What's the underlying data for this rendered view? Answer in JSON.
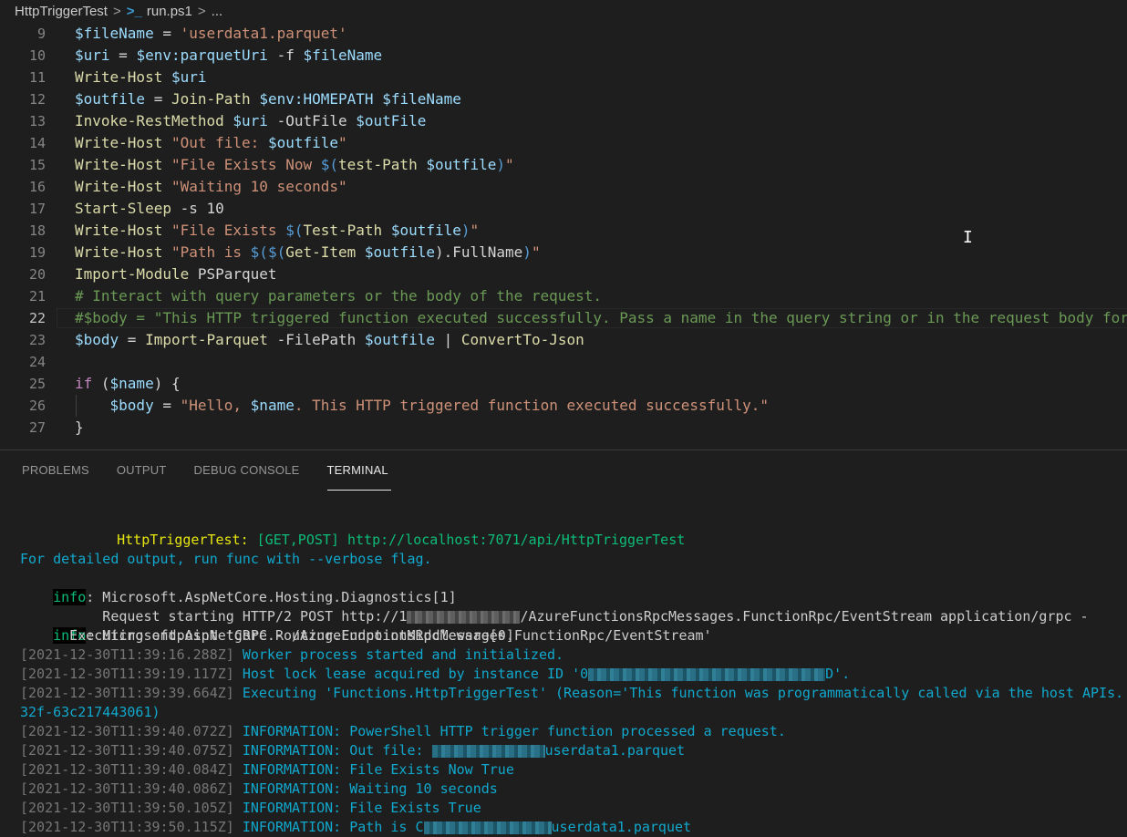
{
  "breadcrumb": {
    "folder": "HttpTriggerTest",
    "separator": ">",
    "file_icon": "powershell-icon",
    "file_icon_glyph": ">_",
    "file": "run.ps1",
    "ellipsis": "..."
  },
  "editor": {
    "language": "powershell",
    "current_line": 22,
    "lines": [
      {
        "n": "9",
        "tokens": [
          [
            "var",
            "$fileName"
          ],
          [
            "op",
            " = "
          ],
          [
            "str",
            "'userdata1.parquet'"
          ]
        ]
      },
      {
        "n": "10",
        "tokens": [
          [
            "var",
            "$uri"
          ],
          [
            "op",
            " = "
          ],
          [
            "var",
            "$env:parquetUri"
          ],
          [
            "op",
            " -f "
          ],
          [
            "var",
            "$fileName"
          ]
        ]
      },
      {
        "n": "11",
        "tokens": [
          [
            "cmd",
            "Write-Host"
          ],
          [
            "op",
            " "
          ],
          [
            "var",
            "$uri"
          ]
        ]
      },
      {
        "n": "12",
        "tokens": [
          [
            "var",
            "$outfile"
          ],
          [
            "op",
            " = "
          ],
          [
            "cmd",
            "Join-Path"
          ],
          [
            "op",
            " "
          ],
          [
            "var",
            "$env:HOMEPATH"
          ],
          [
            "op",
            " "
          ],
          [
            "var",
            "$fileName"
          ]
        ]
      },
      {
        "n": "13",
        "tokens": [
          [
            "cmd",
            "Invoke-RestMethod"
          ],
          [
            "op",
            " "
          ],
          [
            "var",
            "$uri"
          ],
          [
            "op",
            " -OutFile "
          ],
          [
            "var",
            "$outFile"
          ]
        ]
      },
      {
        "n": "14",
        "tokens": [
          [
            "cmd",
            "Write-Host"
          ],
          [
            "op",
            " "
          ],
          [
            "str",
            "\"Out file: "
          ],
          [
            "var",
            "$outfile"
          ],
          [
            "str",
            "\""
          ]
        ]
      },
      {
        "n": "15",
        "tokens": [
          [
            "cmd",
            "Write-Host"
          ],
          [
            "op",
            " "
          ],
          [
            "str",
            "\"File Exists Now "
          ],
          [
            "sub",
            "$("
          ],
          [
            "cmd",
            "test-Path"
          ],
          [
            "op",
            " "
          ],
          [
            "var",
            "$outfile"
          ],
          [
            "sub",
            ")"
          ],
          [
            "str",
            "\""
          ]
        ]
      },
      {
        "n": "16",
        "tokens": [
          [
            "cmd",
            "Write-Host"
          ],
          [
            "op",
            " "
          ],
          [
            "str",
            "\"Waiting 10 seconds\""
          ]
        ]
      },
      {
        "n": "17",
        "tokens": [
          [
            "cmd",
            "Start-Sleep"
          ],
          [
            "op",
            " -s 10"
          ]
        ]
      },
      {
        "n": "18",
        "tokens": [
          [
            "cmd",
            "Write-Host"
          ],
          [
            "op",
            " "
          ],
          [
            "str",
            "\"File Exists "
          ],
          [
            "sub",
            "$("
          ],
          [
            "cmd",
            "Test-Path"
          ],
          [
            "op",
            " "
          ],
          [
            "var",
            "$outfile"
          ],
          [
            "sub",
            ")"
          ],
          [
            "str",
            "\""
          ]
        ]
      },
      {
        "n": "19",
        "tokens": [
          [
            "cmd",
            "Write-Host"
          ],
          [
            "op",
            " "
          ],
          [
            "str",
            "\"Path is "
          ],
          [
            "sub",
            "$($("
          ],
          [
            "cmd",
            "Get-Item"
          ],
          [
            "op",
            " "
          ],
          [
            "var",
            "$outfile"
          ],
          [
            "op",
            ").FullName"
          ],
          [
            "sub",
            ")"
          ],
          [
            "str",
            "\""
          ]
        ]
      },
      {
        "n": "20",
        "tokens": [
          [
            "cmd",
            "Import-Module"
          ],
          [
            "op",
            " PSParquet"
          ]
        ]
      },
      {
        "n": "21",
        "tokens": [
          [
            "cmt",
            "# Interact with query parameters or the body of the request."
          ]
        ]
      },
      {
        "n": "22",
        "tokens": [
          [
            "cmt",
            "#$body = \"This HTTP triggered function executed successfully. Pass a name in the query string or in the request body for a personalized response.\""
          ]
        ]
      },
      {
        "n": "23",
        "tokens": [
          [
            "var",
            "$body"
          ],
          [
            "op",
            " = "
          ],
          [
            "cmd",
            "Import-Parquet"
          ],
          [
            "op",
            " -FilePath "
          ],
          [
            "var",
            "$outfile"
          ],
          [
            "op",
            " | "
          ],
          [
            "cmd",
            "ConvertTo-Json"
          ]
        ]
      },
      {
        "n": "24",
        "tokens": []
      },
      {
        "n": "25",
        "tokens": [
          [
            "kw",
            "if"
          ],
          [
            "op",
            " ("
          ],
          [
            "var",
            "$name"
          ],
          [
            "op",
            ") {"
          ]
        ]
      },
      {
        "n": "26",
        "tokens": [
          [
            "op",
            "    "
          ],
          [
            "var",
            "$body"
          ],
          [
            "op",
            " = "
          ],
          [
            "str",
            "\"Hello, "
          ],
          [
            "var",
            "$name"
          ],
          [
            "str",
            ". This HTTP triggered function executed successfully.\""
          ]
        ]
      },
      {
        "n": "27",
        "tokens": [
          [
            "op",
            "}"
          ]
        ]
      }
    ]
  },
  "panel": {
    "tabs": [
      {
        "label": "PROBLEMS",
        "active": false
      },
      {
        "label": "OUTPUT",
        "active": false
      },
      {
        "label": "DEBUG CONSOLE",
        "active": false
      },
      {
        "label": "TERMINAL",
        "active": true
      }
    ],
    "terminal": {
      "function_name": "HttpTriggerTest:",
      "function_methods": "[GET,POST]",
      "function_url": "http://localhost:7071/api/HttpTriggerTest",
      "verbose_hint": "For detailed output, run func with --verbose flag.",
      "info_label": "info",
      "info1_source": ": Microsoft.AspNetCore.Hosting.Diagnostics[1]",
      "info1_detail_prefix": "      Request starting HTTP/2 POST http://1",
      "info1_detail_suffix": "/AzureFunctionsRpcMessages.FunctionRpc/EventStream application/grpc -",
      "info2_source": ": Microsoft.AspNetCore.Routing.EndpointMiddleware[0]",
      "info2_detail": "      Executing endpoint 'gRPC - /AzureFunctionsRpcMessages.FunctionRpc/EventStream'",
      "logs": [
        {
          "ts": "[2021-12-30T11:39:16.288Z]",
          "msg": " Worker process started and initialized."
        },
        {
          "ts": "[2021-12-30T11:39:19.117Z]",
          "msg_prefix": " Host lock lease acquired by instance ID '0",
          "msg_suffix": "D'."
        },
        {
          "ts": "[2021-12-30T11:39:39.664Z]",
          "msg": " Executing 'Functions.HttpTriggerTest' (Reason='This function was programmatically called via the host APIs.', Id=",
          "wrap": "32f-63c217443061)"
        },
        {
          "ts": "[2021-12-30T11:39:40.072Z]",
          "msg": " INFORMATION: PowerShell HTTP trigger function processed a request."
        },
        {
          "ts": "[2021-12-30T11:39:40.075Z]",
          "msg_prefix": " INFORMATION: Out file: ",
          "msg_suffix": "userdata1.parquet"
        },
        {
          "ts": "[2021-12-30T11:39:40.084Z]",
          "msg": " INFORMATION: File Exists Now True"
        },
        {
          "ts": "[2021-12-30T11:39:40.086Z]",
          "msg": " INFORMATION: Waiting 10 seconds"
        },
        {
          "ts": "[2021-12-30T11:39:50.105Z]",
          "msg": " INFORMATION: File Exists True"
        },
        {
          "ts": "[2021-12-30T11:39:50.115Z]",
          "msg_prefix": " INFORMATION: Path is C",
          "msg_suffix": "userdata1.parquet"
        }
      ]
    }
  },
  "colors": {
    "background": "#1e1e1e",
    "string": "#ce9178",
    "variable": "#9cdcfe",
    "command": "#dcdcaa",
    "comment": "#6a9955",
    "keyword": "#c586c0",
    "terminal_yellow": "#e5e510",
    "terminal_green": "#0dbc79",
    "terminal_cyan": "#11a8cd"
  }
}
